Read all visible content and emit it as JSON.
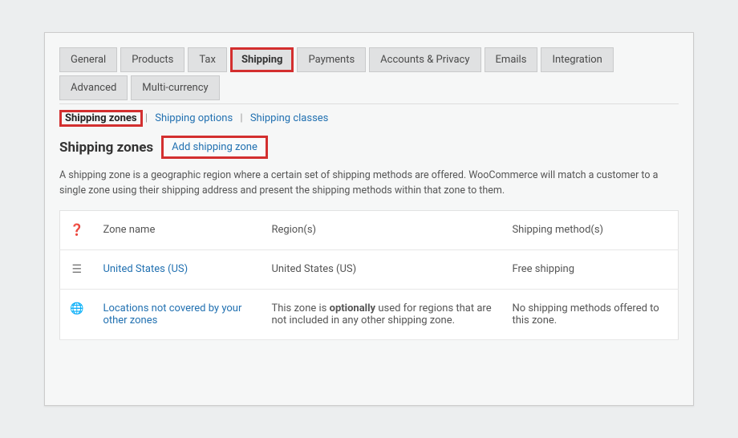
{
  "tabs": {
    "general": "General",
    "products": "Products",
    "tax": "Tax",
    "shipping": "Shipping",
    "payments": "Payments",
    "accounts": "Accounts & Privacy",
    "emails": "Emails",
    "integration": "Integration",
    "advanced": "Advanced",
    "multicurrency": "Multi-currency"
  },
  "subtabs": {
    "zones": "Shipping zones",
    "options": "Shipping options",
    "classes": "Shipping classes"
  },
  "heading": "Shipping zones",
  "add_button": "Add shipping zone",
  "description": "A shipping zone is a geographic region where a certain set of shipping methods are offered. WooCommerce will match a customer to a single zone using their shipping address and present the shipping methods within that zone to them.",
  "columns": {
    "name": "Zone name",
    "region": "Region(s)",
    "method": "Shipping method(s)"
  },
  "rows": [
    {
      "name": "United States (US)",
      "region": "United States (US)",
      "method": "Free shipping"
    },
    {
      "name": "Locations not covered by your other zones",
      "region_pre": "This zone is ",
      "region_bold": "optionally",
      "region_post": " used for regions that are not included in any other shipping zone.",
      "method": "No shipping methods offered to this zone."
    }
  ]
}
